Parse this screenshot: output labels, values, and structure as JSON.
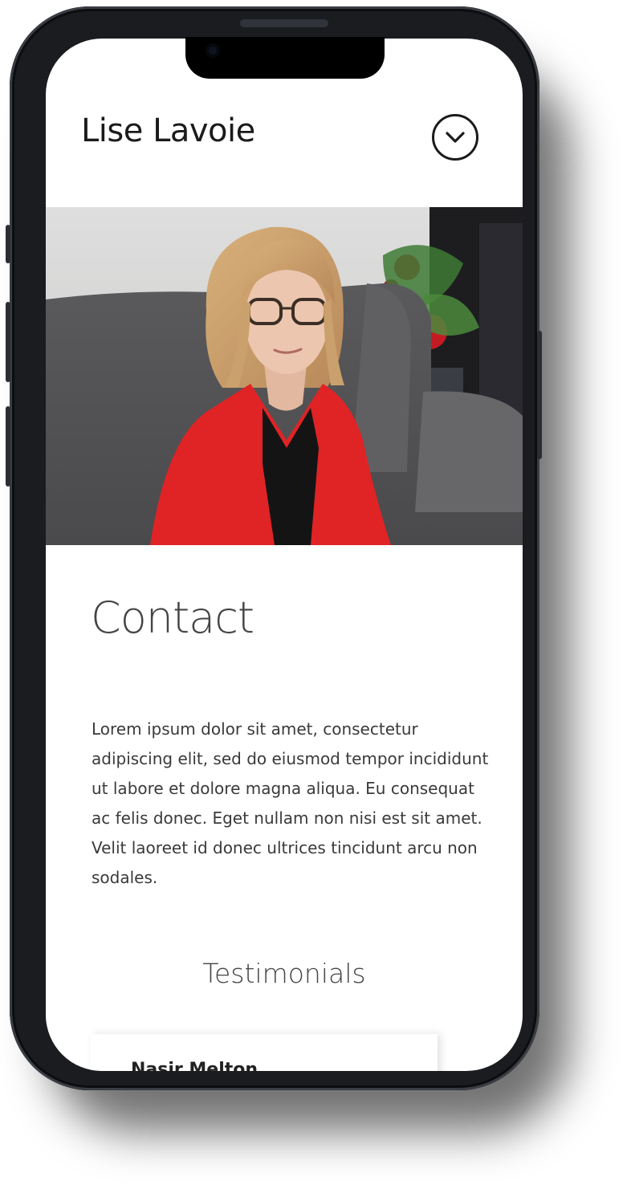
{
  "header": {
    "site_title": "Lise Lavoie",
    "menu_icon": "chevron-down-circle-icon"
  },
  "hero": {
    "image": "portrait-photo"
  },
  "contact": {
    "heading": "Contact",
    "body": "Lorem ipsum dolor sit amet, consectetur adipiscing elit, sed do eiusmod tempor incididunt ut labore et dolore magna aliqua. Eu consequat ac felis donec. Eget nullam non nisi est sit amet. Velit laoreet id donec ultrices tincidunt arcu non sodales."
  },
  "testimonials": {
    "heading": "Testimonials",
    "first_name": "Nasir Melton"
  },
  "colors": {
    "phone_frame": "#1a1c20",
    "text_dark": "#1b1b1b",
    "jacket_red": "#e02325"
  }
}
